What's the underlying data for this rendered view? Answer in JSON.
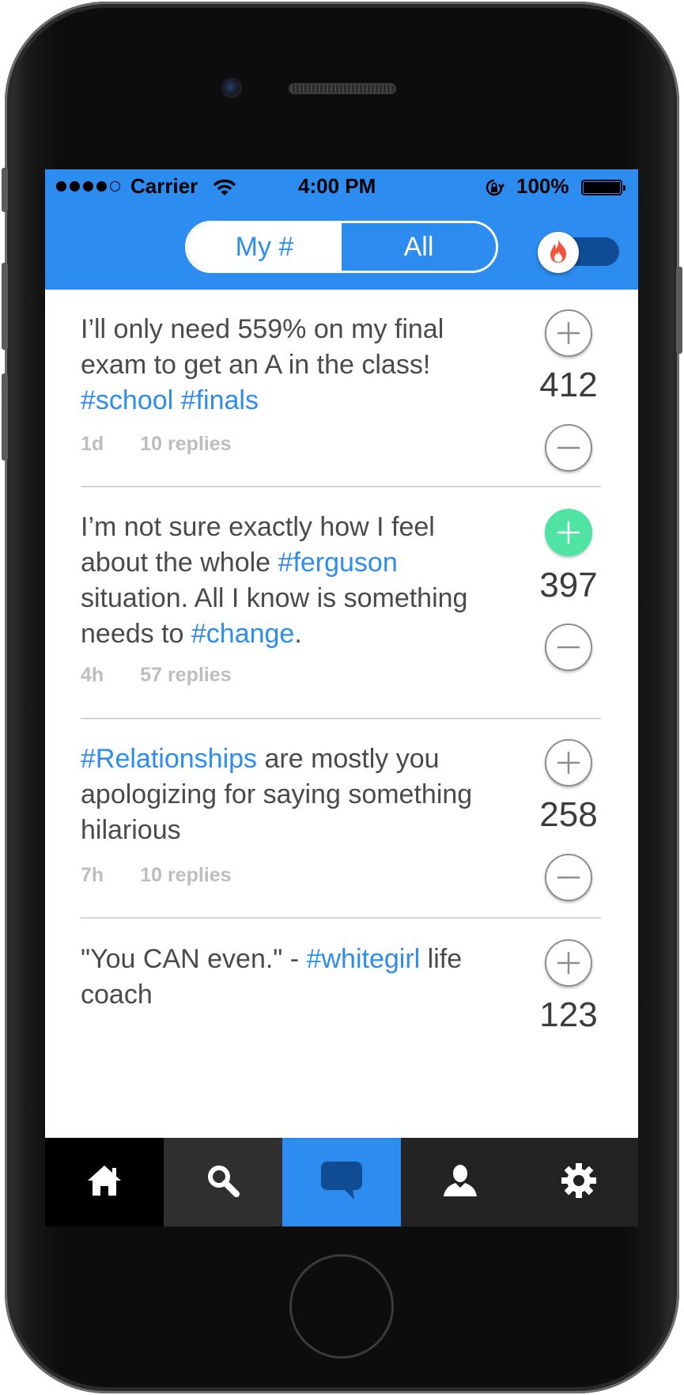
{
  "status_bar": {
    "carrier": "Carrier",
    "time": "4:00 PM",
    "battery_percent": "100%",
    "signal_bars_filled": 4,
    "signal_bars_total": 5
  },
  "header": {
    "segments": [
      {
        "label": "My #",
        "selected": false
      },
      {
        "label": "All",
        "selected": true
      }
    ],
    "hot_toggle": {
      "icon": "flame-icon",
      "on": false
    }
  },
  "posts": [
    {
      "text_parts": [
        {
          "text": "I’ll only need 559% on my final exam to get an A in the class! ",
          "tag": false
        },
        {
          "text": "#school",
          "tag": true
        },
        {
          "text": " ",
          "tag": false
        },
        {
          "text": "#finals",
          "tag": true
        }
      ],
      "age": "1d",
      "replies": "10 replies",
      "score": "412",
      "upvoted": false
    },
    {
      "text_parts": [
        {
          "text": "I’m not sure exactly how I feel about the whole ",
          "tag": false
        },
        {
          "text": "#ferguson",
          "tag": true
        },
        {
          "text": " situation. All I know is something needs to ",
          "tag": false
        },
        {
          "text": "#change",
          "tag": true
        },
        {
          "text": ".",
          "tag": false
        }
      ],
      "age": "4h",
      "replies": "57 replies",
      "score": "397",
      "upvoted": true
    },
    {
      "text_parts": [
        {
          "text": "#Relationships",
          "tag": true
        },
        {
          "text": " are mostly you apologizing for saying something hilarious",
          "tag": false
        }
      ],
      "age": "7h",
      "replies": "10 replies",
      "score": "258",
      "upvoted": false
    },
    {
      "text_parts": [
        {
          "text": "\"You CAN even.\" - ",
          "tag": false
        },
        {
          "text": "#whitegirl",
          "tag": true
        },
        {
          "text": " life coach",
          "tag": false
        }
      ],
      "age": "",
      "replies": "",
      "score": "123",
      "upvoted": false
    }
  ],
  "tab_bar": {
    "tabs": [
      {
        "icon": "home-icon",
        "selected": false
      },
      {
        "icon": "search-icon",
        "selected": false
      },
      {
        "icon": "chat-bubble-icon",
        "selected": true
      },
      {
        "icon": "person-icon",
        "selected": false
      },
      {
        "icon": "gear-icon",
        "selected": false
      }
    ]
  },
  "colors": {
    "accent": "#2d8cf0",
    "upvote_active": "#4fe3a4",
    "hashtag": "#2d8cf0",
    "flame": "#f2553a"
  }
}
